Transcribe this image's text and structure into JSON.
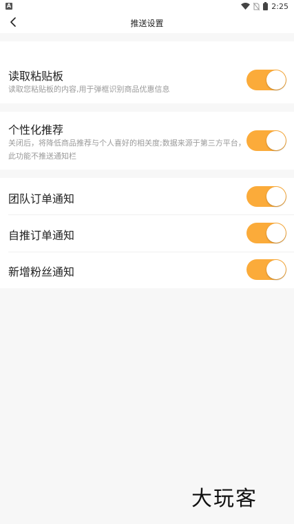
{
  "status_bar": {
    "left_badge": "A",
    "time": "2:25",
    "icons": [
      "wifi-icon",
      "no-sim-icon",
      "battery-icon"
    ]
  },
  "nav": {
    "title": "推送设置",
    "back_icon": "chevron-left-icon"
  },
  "settings": [
    {
      "title": "读取粘贴板",
      "description": "读取您粘贴板的内容,用于弹框识别商品优惠信息",
      "enabled": true
    },
    {
      "title": "个性化推荐",
      "description": "关闭后，将降低商品推荐与个人喜好的相关度;数据来源于第三方平台，此功能不推送通知栏",
      "enabled": true
    },
    {
      "title": "团队订单通知",
      "enabled": true
    },
    {
      "title": "自推订单通知",
      "enabled": true
    },
    {
      "title": "新增粉丝通知",
      "enabled": true
    }
  ],
  "colors": {
    "toggle_on": "#fbab3a",
    "background": "#f7f7f7"
  },
  "watermark": "大玩客"
}
